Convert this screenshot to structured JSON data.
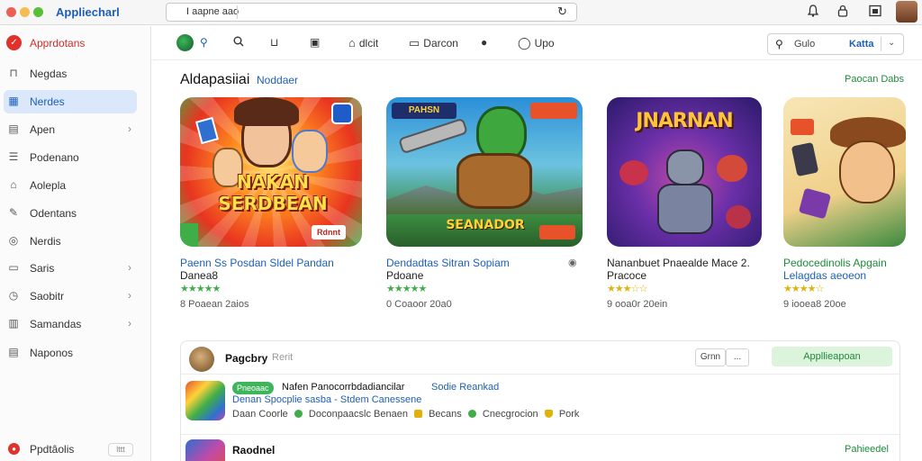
{
  "window": {
    "app_title": "Appliecharl",
    "address_text": "I aapne aao",
    "traffic_colors": [
      "#ec5f57",
      "#f5bd4f",
      "#57c038"
    ]
  },
  "sidebar": {
    "items": [
      {
        "label": "Apprdotans",
        "icon": "brand-logo-icon",
        "chevron": false
      },
      {
        "label": "Negdas",
        "icon": "bag-icon",
        "chevron": false
      },
      {
        "label": "Nerdes",
        "icon": "grid-icon",
        "chevron": false,
        "active": true
      },
      {
        "label": "Apen",
        "icon": "document-icon",
        "chevron": true
      },
      {
        "label": "Podenano",
        "icon": "list-icon",
        "chevron": false
      },
      {
        "label": "Aolepla",
        "icon": "tag-icon",
        "chevron": false
      },
      {
        "label": "Odentans",
        "icon": "pencil-icon",
        "chevron": false
      },
      {
        "label": "Nerdis",
        "icon": "person-icon",
        "chevron": false
      },
      {
        "label": "Saris",
        "icon": "box-icon",
        "chevron": true
      },
      {
        "label": "Saobitr",
        "icon": "clock-icon",
        "chevron": true
      },
      {
        "label": "Samandas",
        "icon": "table-icon",
        "chevron": true
      },
      {
        "label": "Naponos",
        "icon": "inbox-icon",
        "chevron": false
      }
    ],
    "footer": {
      "label": "Ppdtâolis",
      "badge": "lttt"
    }
  },
  "toolbar": {
    "items": [
      {
        "label": "",
        "icon": "binoculars-icon"
      },
      {
        "label": "",
        "icon": "search-icon"
      },
      {
        "label": "",
        "icon": "chart-icon"
      },
      {
        "label": "",
        "icon": "image-icon"
      },
      {
        "label": "dlcit",
        "icon": "house-icon"
      },
      {
        "label": "Darcon",
        "icon": "folder-icon"
      },
      {
        "label": "",
        "icon": "chat-icon"
      },
      {
        "label": "Upo",
        "icon": "bubble-icon"
      }
    ],
    "search": {
      "text": "Gulo",
      "button": "Katta"
    }
  },
  "section": {
    "title": "Aldapasiiai",
    "subtitle": "Noddaer",
    "link": "Paocan Dabs"
  },
  "cards": [
    {
      "art_text": "NAKAN\nSERDBEAN",
      "badge": "Rdnnt",
      "title": "Paenn Ss Posdan Sldel Pandan",
      "title2": "Danea8",
      "stars": "★★★★★",
      "meta": "8 Poaean 2aios"
    },
    {
      "art_text": "SEANADOR",
      "badge": "PAHSN",
      "title": "Dendadtas Sitran Sopiam",
      "title2": "Pdoane",
      "stars": "★★★★★",
      "meta": "0 Coaoor 20a0",
      "verified": true
    },
    {
      "art_text": "JNARNAN",
      "badge": "",
      "title": "Nananbuet Pnaealde Mace 2.",
      "title2": "Pracoce",
      "stars": "★★★☆☆",
      "meta": "9 ooa0r 20ein",
      "verified": false
    },
    {
      "art_text": "",
      "badge": "",
      "title": "Pedocedinolis Apgain",
      "title2": "Lelagdas aeoeon",
      "stars": "★★★★☆",
      "meta": "9 iooea8 20oe",
      "verified": false
    }
  ],
  "panel": {
    "title": "Pagcbry",
    "subtitle": "Rerit",
    "small_buttons": [
      "Grnn",
      "..."
    ],
    "green_button": "Appllieapoan",
    "row1": {
      "tag": "Pneoaac",
      "name": "Nafen Panocorrbdadiancilar",
      "rank": "Sodie Reankad",
      "line2": "Denan Spocplie sasba - Stdem Canessene",
      "meta": [
        "Daan Coorle",
        "Doconpaacslc Benaen",
        "Becans",
        "Cnecgrocion",
        "Pork"
      ]
    },
    "row2": {
      "name": "Raodnel",
      "link": "Pahieedel"
    }
  }
}
